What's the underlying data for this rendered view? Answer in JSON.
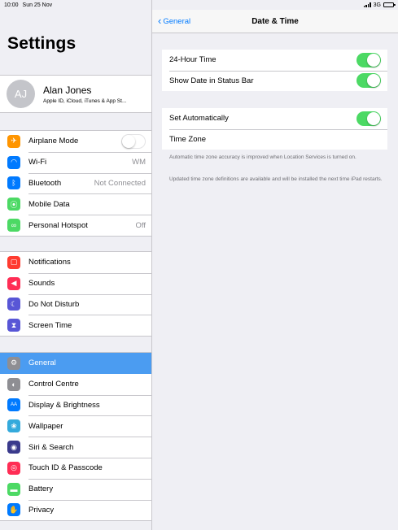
{
  "status_bar": {
    "time": "10:00",
    "date": "Sun 25 Nov",
    "network": "3G"
  },
  "master": {
    "title": "Settings",
    "profile": {
      "initials": "AJ",
      "name": "Alan Jones",
      "subtitle": "Apple ID, iCloud, iTunes & App St..."
    },
    "group1": [
      {
        "label": "Airplane Mode",
        "icon": "airplane-icon",
        "color": "#ff9500",
        "glyph": "✈",
        "toggle": "off"
      },
      {
        "label": "Wi-Fi",
        "icon": "wifi-icon",
        "color": "#007aff",
        "glyph": "◠",
        "value": "WM"
      },
      {
        "label": "Bluetooth",
        "icon": "bluetooth-icon",
        "color": "#007aff",
        "glyph": "ᛒ",
        "value": "Not Connected"
      },
      {
        "label": "Mobile Data",
        "icon": "mobile-data-icon",
        "color": "#4cd964",
        "glyph": "⦿"
      },
      {
        "label": "Personal Hotspot",
        "icon": "hotspot-icon",
        "color": "#4cd964",
        "glyph": "∞",
        "value": "Off"
      }
    ],
    "group2": [
      {
        "label": "Notifications",
        "icon": "notifications-icon",
        "color": "#ff3b30",
        "glyph": "▢"
      },
      {
        "label": "Sounds",
        "icon": "sounds-icon",
        "color": "#ff2d55",
        "glyph": "◀"
      },
      {
        "label": "Do Not Disturb",
        "icon": "moon-icon",
        "color": "#5856d6",
        "glyph": "☾"
      },
      {
        "label": "Screen Time",
        "icon": "hourglass-icon",
        "color": "#5856d6",
        "glyph": "⧗"
      }
    ],
    "group3": [
      {
        "label": "General",
        "icon": "gear-icon",
        "color": "#8e8e93",
        "glyph": "⚙",
        "selected": true
      },
      {
        "label": "Control Centre",
        "icon": "control-centre-icon",
        "color": "#8e8e93",
        "glyph": "◐"
      },
      {
        "label": "Display & Brightness",
        "icon": "display-icon",
        "color": "#007aff",
        "glyph": "AA"
      },
      {
        "label": "Wallpaper",
        "icon": "wallpaper-icon",
        "color": "#34aadc",
        "glyph": "❀"
      },
      {
        "label": "Siri & Search",
        "icon": "siri-icon",
        "color": "#3a3a8c",
        "glyph": "◉"
      },
      {
        "label": "Touch ID & Passcode",
        "icon": "fingerprint-icon",
        "color": "#ff2d55",
        "glyph": "◎"
      },
      {
        "label": "Battery",
        "icon": "battery-icon",
        "color": "#4cd964",
        "glyph": "▬"
      },
      {
        "label": "Privacy",
        "icon": "hand-icon",
        "color": "#007aff",
        "glyph": "✋"
      }
    ]
  },
  "detail": {
    "back_label": "General",
    "title": "Date & Time",
    "group1": [
      {
        "label": "24-Hour Time",
        "toggle": "on"
      },
      {
        "label": "Show Date in Status Bar",
        "toggle": "on"
      }
    ],
    "group2": [
      {
        "label": "Set Automatically",
        "toggle": "on"
      },
      {
        "label": "Time Zone"
      }
    ],
    "footnote1": "Automatic time zone accuracy is improved when Location Services is turned on.",
    "footnote2": "Updated time zone definitions are available and will be installed the next time iPad restarts."
  },
  "colors": {
    "accent": "#007aff",
    "toggle_on": "#4cd964",
    "selected_row": "#4b9cf1"
  }
}
